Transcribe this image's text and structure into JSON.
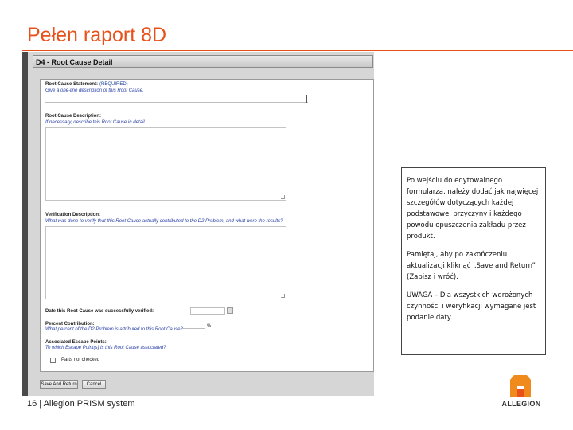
{
  "slide": {
    "title": "Pełen raport 8D",
    "footer": "16 | Allegion PRISM system"
  },
  "panel": {
    "header": "D4 - Root Cause Detail",
    "fields": {
      "statement_label": "Root Cause Statement:",
      "statement_required": "(REQUIRED)",
      "statement_help": "Give a one-line description of this Root Cause.",
      "description_label": "Root Cause Description:",
      "description_help": "If necessary, describe this Root Cause in detail.",
      "verification_label": "Verification Description:",
      "verification_help": "What was done to verify that this Root Cause actually contributed to the D2 Problem, and what were the results?",
      "date_label": "Date this Root Cause was successfully verified:",
      "percent_label": "Percent Contribution:",
      "percent_help": "What percent of the D2 Problem is attributed to this Root Cause?",
      "percent_unit": "%",
      "escape_label": "Associated Escape Points:",
      "escape_help": "To which Escape Point(s) is this Root Cause associated?",
      "escape_option": "Parts not checked"
    },
    "buttons": {
      "save": "Save And Return",
      "cancel": "Cancel"
    }
  },
  "callout": {
    "p1": "Po wejściu do edytowalnego formularza, należy dodać jak najwięcej szczegółów dotyczących każdej podstawowej przyczyny i każdego powodu opuszczenia zakładu przez produkt.",
    "p2": "Pamiętaj, aby po zakończeniu aktualizacji kliknąć „Save and Return” (Zapisz i wróć).",
    "p3": "UWAGA – Dla wszystkich wdrożonych czynności i weryfikacji wymagane jest podanie daty."
  },
  "logo": {
    "text": "ALLEGION",
    "color": "#f08a1c",
    "accent": "#e8521a"
  }
}
